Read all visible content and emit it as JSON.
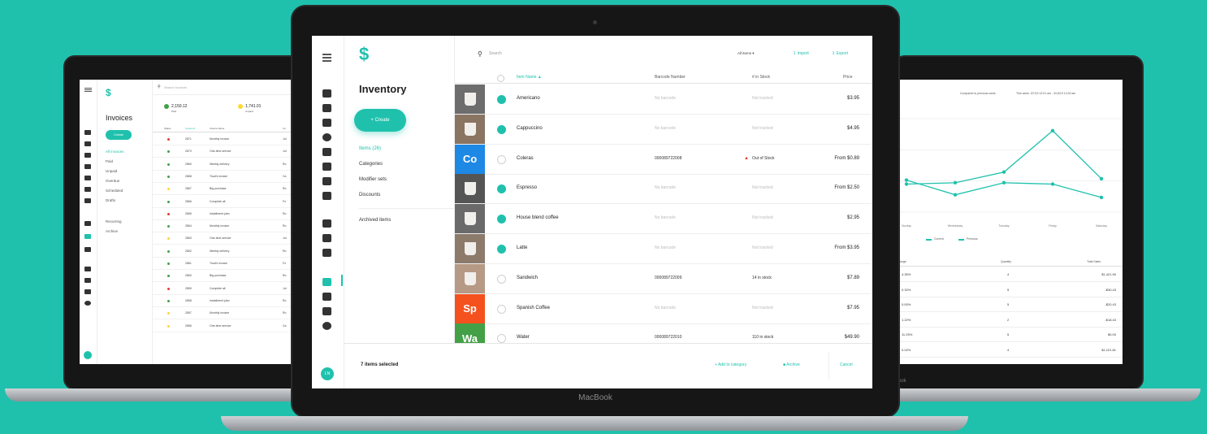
{
  "invoices": {
    "search_placeholder": "Search invoices",
    "title": "Invoices",
    "create_label": "Create",
    "nav": [
      "All invoices",
      "Paid",
      "Unpaid",
      "Overdue",
      "Scheduled",
      "Drafts"
    ],
    "nav2": [
      "Recurring",
      "Archive"
    ],
    "stat1_value": "2,150.12",
    "stat1_label": "Paid",
    "stat2_value": "1,741.01",
    "stat2_label": "Unpaid",
    "columns": [
      "Status",
      "Invoice #",
      "Invoice Name",
      "Cu"
    ],
    "rows": [
      {
        "num": "2871",
        "name": "Monthly invoice",
        "c": "Jul",
        "color": "#e53935"
      },
      {
        "num": "2870",
        "name": "One-time service",
        "c": "Jul",
        "color": "#43a047"
      },
      {
        "num": "2869",
        "name": "Weekly delivery",
        "c": "Ro",
        "color": "#43a047"
      },
      {
        "num": "2868",
        "name": "Trual's invoice",
        "c": "Ca",
        "color": "#43a047"
      },
      {
        "num": "2867",
        "name": "Big purchase",
        "c": "Ro",
        "color": "#fdd835"
      },
      {
        "num": "2866",
        "name": "Complete all",
        "c": "Fo",
        "color": "#43a047"
      },
      {
        "num": "2865",
        "name": "Installment plan",
        "c": "Ro",
        "color": "#e53935"
      },
      {
        "num": "2864",
        "name": "Monthly invoice",
        "c": "Ro",
        "color": "#43a047"
      },
      {
        "num": "2863",
        "name": "One-time service",
        "c": "Jul",
        "color": "#fdd835"
      },
      {
        "num": "2862",
        "name": "Weekly delivery",
        "c": "Ro",
        "color": "#43a047"
      },
      {
        "num": "2861",
        "name": "Trual's invoice",
        "c": "Fo",
        "color": "#43a047"
      },
      {
        "num": "2860",
        "name": "Big purchase",
        "c": "Ro",
        "color": "#43a047"
      },
      {
        "num": "2859",
        "name": "Complete all",
        "c": "Jul",
        "color": "#e53935"
      },
      {
        "num": "2858",
        "name": "Installment plan",
        "c": "Ro",
        "color": "#43a047"
      },
      {
        "num": "2857",
        "name": "Monthly invoice",
        "c": "Ro",
        "color": "#fdd835"
      },
      {
        "num": "2856",
        "name": "One-time service",
        "c": "Ca",
        "color": "#fdd835"
      }
    ]
  },
  "inventory": {
    "search_placeholder": "Search",
    "filter_label": "All items",
    "import_label": "Import",
    "export_label": "Export",
    "title": "Inventory",
    "create_label": "Create",
    "nav": [
      "Items (26)",
      "Categories",
      "Modifier sets",
      "Discounts"
    ],
    "archived_label": "Archived items",
    "columns": {
      "name": "Item Name",
      "barcode": "Barcode Number",
      "stock": "# in Stock",
      "price": "Price"
    },
    "rows": [
      {
        "name": "Americano",
        "barcode": "No barcode",
        "stock": "Not tracked",
        "price": "$3.95",
        "checked": true,
        "thumb": "#6d6d6d",
        "abbr": ""
      },
      {
        "name": "Cappuccino",
        "barcode": "No barcode",
        "stock": "Not tracked",
        "price": "$4.95",
        "checked": true,
        "thumb": "#8a7462",
        "abbr": ""
      },
      {
        "name": "Coleras",
        "barcode": "000089722008",
        "stock": "Out of Stock",
        "price": "From $0.89",
        "checked": false,
        "thumb": "#1e88e5",
        "abbr": "Co"
      },
      {
        "name": "Espresso",
        "barcode": "No barcode",
        "stock": "Not tracked",
        "price": "From $2.50",
        "checked": true,
        "thumb": "#555555",
        "abbr": ""
      },
      {
        "name": "House blend coffee",
        "barcode": "No barcode",
        "stock": "Not tracked",
        "price": "$2.95",
        "checked": true,
        "thumb": "#6a6a6a",
        "abbr": ""
      },
      {
        "name": "Latte",
        "barcode": "No barcode",
        "stock": "Not tracked",
        "price": "From $3.95",
        "checked": true,
        "thumb": "#8c7a6b",
        "abbr": ""
      },
      {
        "name": "Sandwich",
        "barcode": "000089722009",
        "stock": "14 in stock",
        "price": "$7.89",
        "checked": false,
        "thumb": "#b69a85",
        "abbr": ""
      },
      {
        "name": "Spanish Coffee",
        "barcode": "No barcode",
        "stock": "Not tracked",
        "price": "$7.95",
        "checked": false,
        "thumb": "#f4511e",
        "abbr": "Sp"
      },
      {
        "name": "Water",
        "barcode": "000089722010",
        "stock": "110 in stock",
        "price": "$49.90",
        "checked": false,
        "thumb": "#43a047",
        "abbr": "Wa"
      }
    ],
    "selected_label": "7 items selected",
    "add_category_label": "Add to category",
    "archive_label": "Archive",
    "cancel_label": "Cancel",
    "avatar": "LN",
    "accent": "#1fc1ad"
  },
  "macbook_label": "MacBook",
  "right_macbook_label": "ook",
  "report": {
    "compare_label": "Compared to previous week",
    "range_label": "This week: 3/7/19 12:01 am - 3/13/19 12:00 am",
    "legend_current": "Current",
    "legend_previous": "Previous",
    "columns": [
      "ange",
      "Quantity",
      "Total Sales"
    ],
    "rows": [
      {
        "c": "4.35%",
        "q": "4",
        "t": "$1,421.90"
      },
      {
        "c": "0.32%",
        "q": "5",
        "t": "-$30.43"
      },
      {
        "c": "0.00%",
        "q": "5",
        "t": "-$20.43"
      },
      {
        "c": "1.22%",
        "q": "2",
        "t": "-$18.43"
      },
      {
        "c": "11.25%",
        "q": "5",
        "t": "$0.00"
      },
      {
        "c": "0.02%",
        "q": "4",
        "t": "$1,101.81"
      }
    ]
  },
  "chart_data": {
    "type": "line",
    "title": "",
    "xlabel": "",
    "ylabel": "",
    "x": [
      "Sunday",
      "Wednesday",
      "Tuesday",
      "Friday",
      "Saturday"
    ],
    "series": [
      {
        "name": "Current",
        "values": [
          21,
          22,
          30,
          61,
          25
        ],
        "color": "#1fc1ad"
      },
      {
        "name": "Previous",
        "values": [
          24,
          13,
          22,
          21,
          11
        ],
        "color": "#1fc1ad"
      }
    ],
    "ylim": [
      0,
      70
    ],
    "legend": "bottom"
  }
}
